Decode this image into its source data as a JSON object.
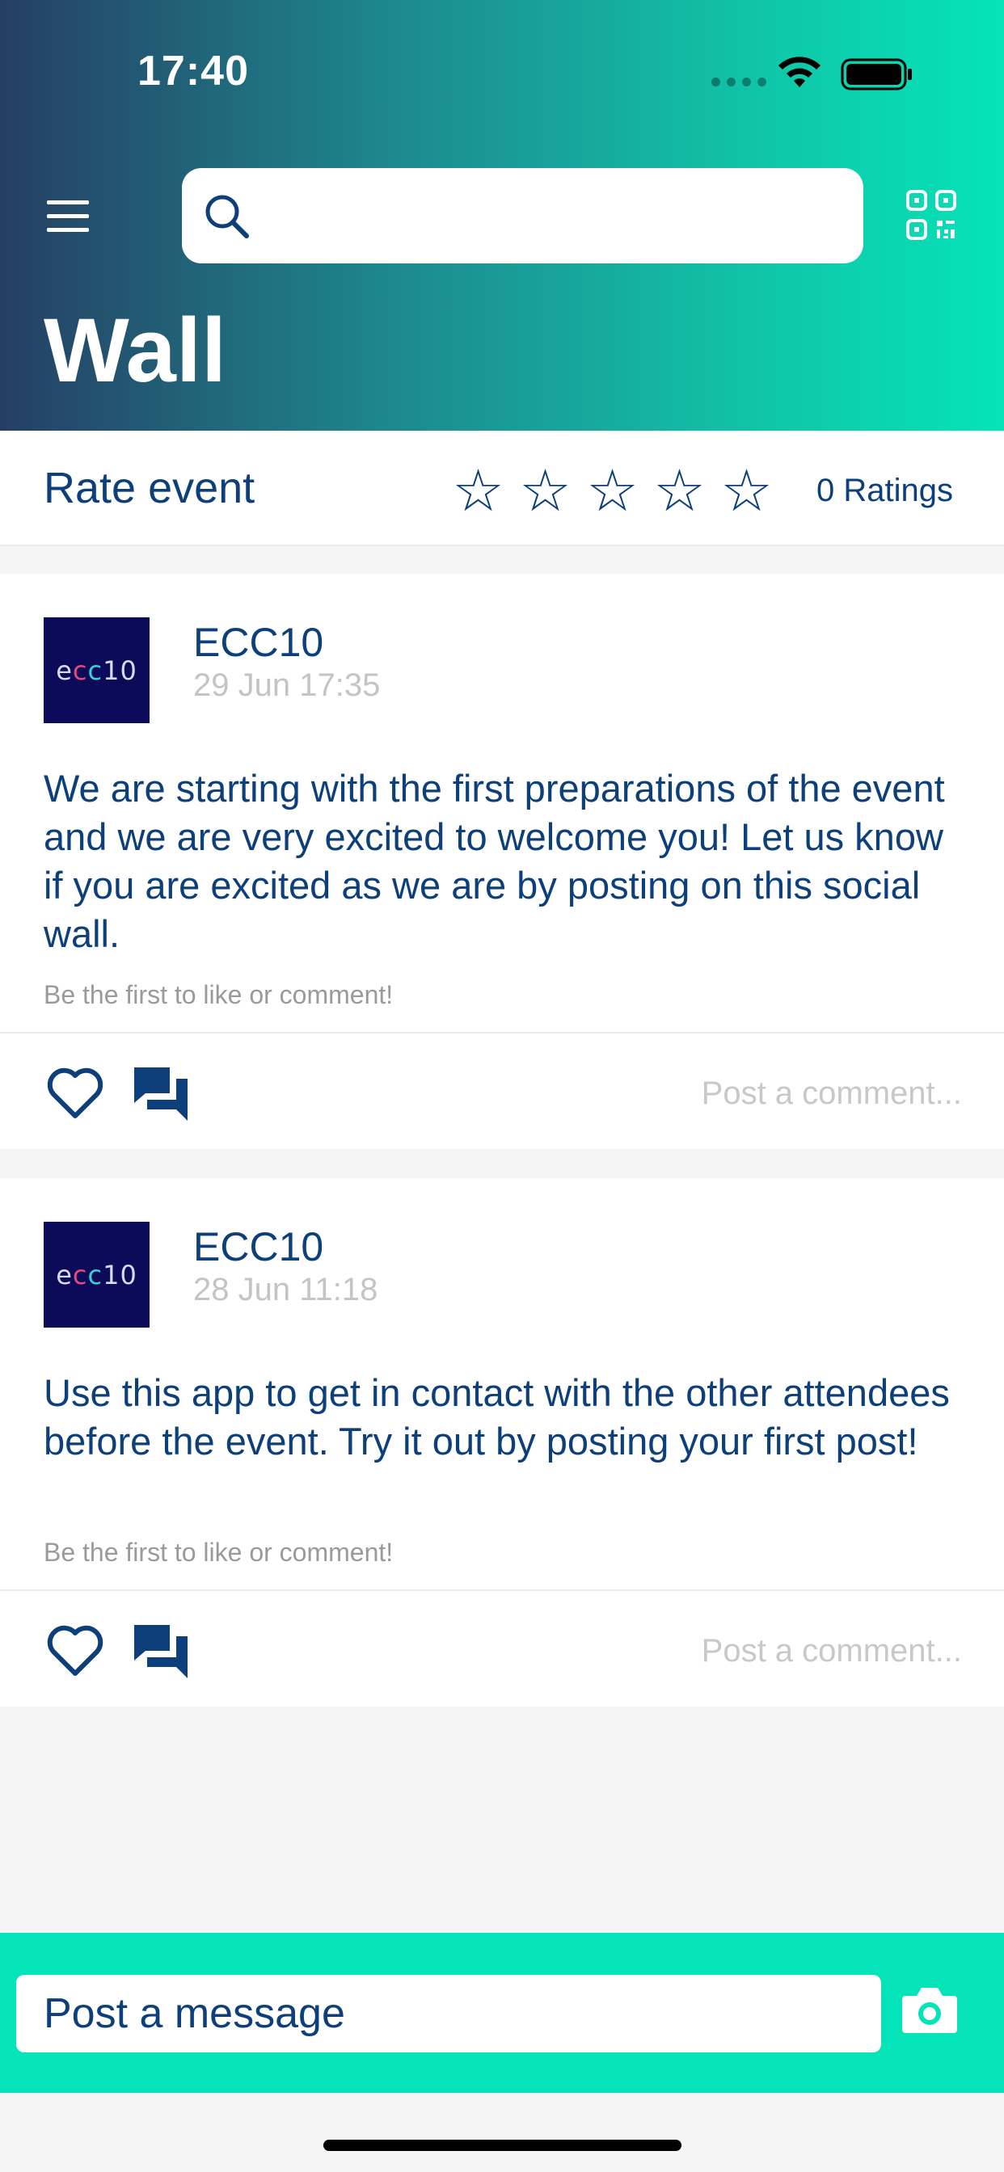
{
  "status_bar": {
    "time": "17:40"
  },
  "header": {
    "title": "Wall",
    "search": {
      "placeholder": ""
    }
  },
  "rating": {
    "label": "Rate event",
    "stars": [
      "☆",
      "☆",
      "☆",
      "☆",
      "☆"
    ],
    "value": 0,
    "count_label": "0 Ratings"
  },
  "posts": [
    {
      "avatar_logo": {
        "e": "e",
        "c1": "c",
        "c2": "c",
        "n": "10"
      },
      "author": "ECC10",
      "timestamp": "29 Jun 17:35",
      "text": "We are starting with the first preparations of the event and we are very excited to welcome you! Let us know if you are excited as we are by posting on this social wall.",
      "hint": "Be the first to like or comment!",
      "comment_placeholder": "Post a comment..."
    },
    {
      "avatar_logo": {
        "e": "e",
        "c1": "c",
        "c2": "c",
        "n": "10"
      },
      "author": "ECC10",
      "timestamp": "28 Jun 11:18",
      "text": "Use this app to get in contact with the other attendees before the event. Try it out by posting your first post!",
      "hint": "Be the first to like or comment!",
      "comment_placeholder": "Post a comment..."
    }
  ],
  "composer": {
    "placeholder": "Post a message"
  },
  "icons": {
    "menu": "menu-icon",
    "search": "search-icon",
    "qr": "qr-code-icon",
    "heart": "heart-icon",
    "comment": "comment-icon",
    "camera": "camera-icon"
  },
  "colors": {
    "accent": "#05e4b8",
    "text_primary": "#0d3f7a",
    "header_gradient_start": "#253f63",
    "header_gradient_end": "#05e4b8"
  }
}
